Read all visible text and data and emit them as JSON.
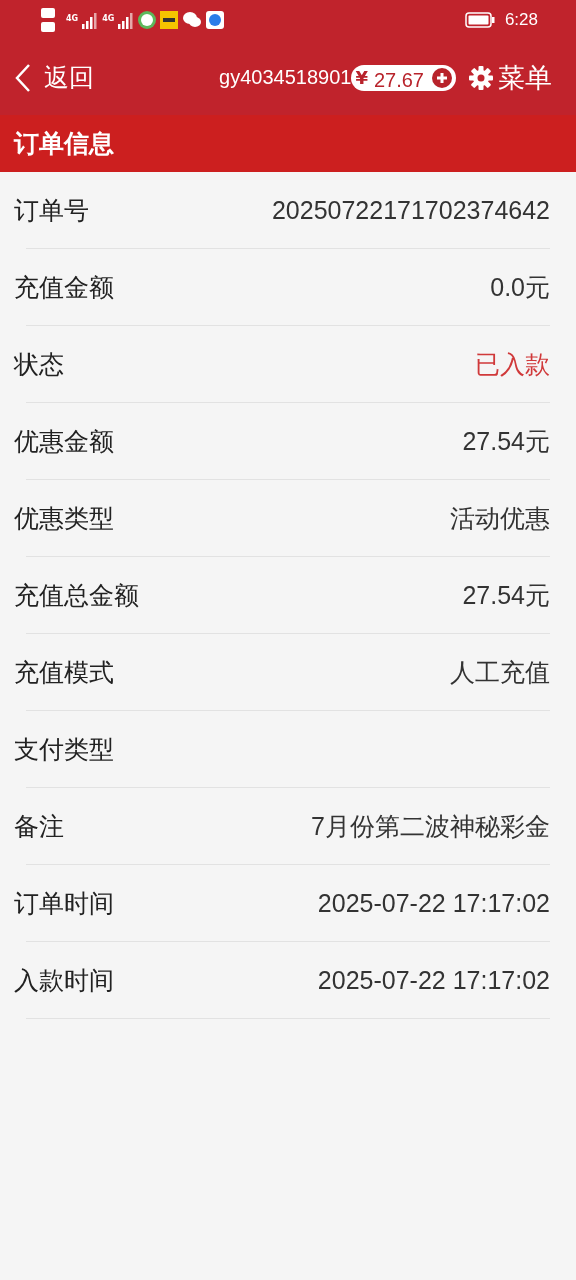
{
  "status_bar": {
    "network": [
      "4G",
      "4G"
    ],
    "time": "6:28"
  },
  "header": {
    "back": "返回",
    "account": "gy4034518901",
    "currency": "¥",
    "balance": "27.67",
    "menu": "菜单"
  },
  "section": {
    "title": "订单信息"
  },
  "rows": [
    {
      "label": "订单号",
      "value": "20250722171702374642",
      "kind": "normal"
    },
    {
      "label": "充值金额",
      "value": "0.0元",
      "kind": "normal"
    },
    {
      "label": "状态",
      "value": "已入款",
      "kind": "status"
    },
    {
      "label": "优惠金额",
      "value": "27.54元",
      "kind": "normal"
    },
    {
      "label": "优惠类型",
      "value": "活动优惠",
      "kind": "normal"
    },
    {
      "label": "充值总金额",
      "value": "27.54元",
      "kind": "normal"
    },
    {
      "label": "充值模式",
      "value": "人工充值",
      "kind": "normal"
    },
    {
      "label": "支付类型",
      "kind": "normal"
    },
    {
      "label": "备注",
      "value": "7月份第二波神秘彩金",
      "kind": "normal"
    },
    {
      "label": "订单时间",
      "value": "2025-07-22 17:17:02",
      "kind": "normal"
    },
    {
      "label": "入款时间",
      "value": "2025-07-22 17:17:02",
      "kind": "normal"
    }
  ]
}
